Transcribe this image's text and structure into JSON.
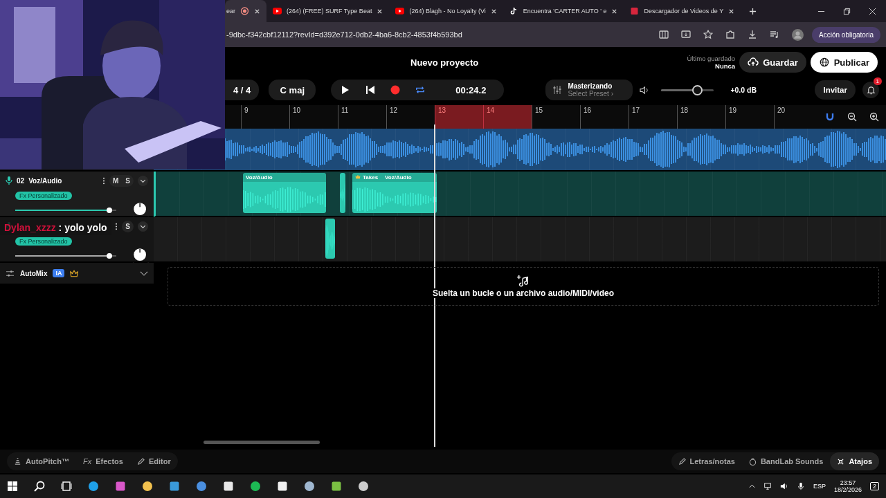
{
  "browser": {
    "tabs": [
      {
        "title": "ear",
        "kind": "recording",
        "selected": true
      },
      {
        "title": "(264) (FREE) SURF Type Beat",
        "kind": "youtube",
        "selected": false
      },
      {
        "title": "(264) Blagh - No Loyalty (Vi",
        "kind": "youtube",
        "selected": false
      },
      {
        "title": "Encuentra 'CARTER AUTO ' e",
        "kind": "tiktok",
        "selected": false
      },
      {
        "title": "Descargador de Videos de Y",
        "kind": "site",
        "selected": false
      }
    ],
    "address": "-9dbc-f342cbf12112?revId=d392e712-0db2-4ba6-8cb2-4853f4b593bd",
    "action_button": "Acción obligatoria"
  },
  "project": {
    "title": "Nuevo proyecto",
    "last_saved_label": "Último guardado",
    "last_saved": "Nunca",
    "save": "Guardar",
    "publish": "Publicar"
  },
  "transport": {
    "time_signature": "4 / 4",
    "key": "C maj",
    "recording": true,
    "loop": true,
    "time": "00:24.2",
    "mastering": "Masterizando",
    "preset": "Select Preset ›",
    "volume": {
      "level": 0.68
    },
    "gain": "+0.0 dB",
    "invite": "Invitar",
    "notifications": "1"
  },
  "ruler": {
    "bars": [
      {
        "label": "9",
        "in_loop": false
      },
      {
        "label": "10",
        "in_loop": false
      },
      {
        "label": "11",
        "in_loop": false
      },
      {
        "label": "12",
        "in_loop": false
      },
      {
        "label": "13",
        "in_loop": true
      },
      {
        "label": "14",
        "in_loop": true
      },
      {
        "label": "15",
        "in_loop": false
      },
      {
        "label": "16",
        "in_loop": false
      },
      {
        "label": "17",
        "in_loop": false
      },
      {
        "label": "18",
        "in_loop": false
      },
      {
        "label": "19",
        "in_loop": false
      },
      {
        "label": "20",
        "in_loop": false
      }
    ]
  },
  "tracks": [
    {
      "kind": "lane",
      "color": "#3b8fe0"
    },
    {
      "kind": "audio",
      "number": "02",
      "name": "Voz/Audio",
      "fx": "Fx Personalizado",
      "mute": "M",
      "solo": "S",
      "selected": true,
      "volume": {
        "level": 0.93
      },
      "color": "#2cc9b0",
      "clips": [
        {
          "kind": "clip",
          "label": "Voz/Audio"
        },
        {
          "kind": "clip"
        },
        {
          "kind": "clip",
          "takes": "Takes",
          "label": "Voz/Audio"
        }
      ]
    },
    {
      "kind": "audio",
      "fx": "Fx Personalizado",
      "solo": "S",
      "selected": false,
      "volume": {
        "level": 0.93
      },
      "color": "#2cc9b0",
      "clips": [
        {
          "kind": "clip"
        }
      ]
    }
  ],
  "automix": {
    "label": "AutoMix",
    "badge": "IA"
  },
  "drop_zone": "Suelta un bucle o un archivo audio/MIDI/video",
  "bottom_bar": {
    "left": [
      {
        "label": "AutoPitch™",
        "kind": "autopitch"
      },
      {
        "label": "Efectos",
        "kind": "fx",
        "prefix": "Fx"
      },
      {
        "label": "Editor",
        "kind": "editor"
      }
    ],
    "right": [
      {
        "label": "Letras/notas",
        "kind": "lyrics",
        "selected": false
      },
      {
        "label": "BandLab Sounds",
        "kind": "sounds",
        "selected": false
      },
      {
        "label": "Atajos",
        "kind": "shortcuts",
        "selected": true
      }
    ]
  },
  "chat": {
    "user": "Dylan_xzzz",
    "message": ": yolo yolo"
  },
  "taskbar": {
    "language": "ESP",
    "time": "23:57",
    "date": "18/2/2026",
    "notifications": "2"
  }
}
